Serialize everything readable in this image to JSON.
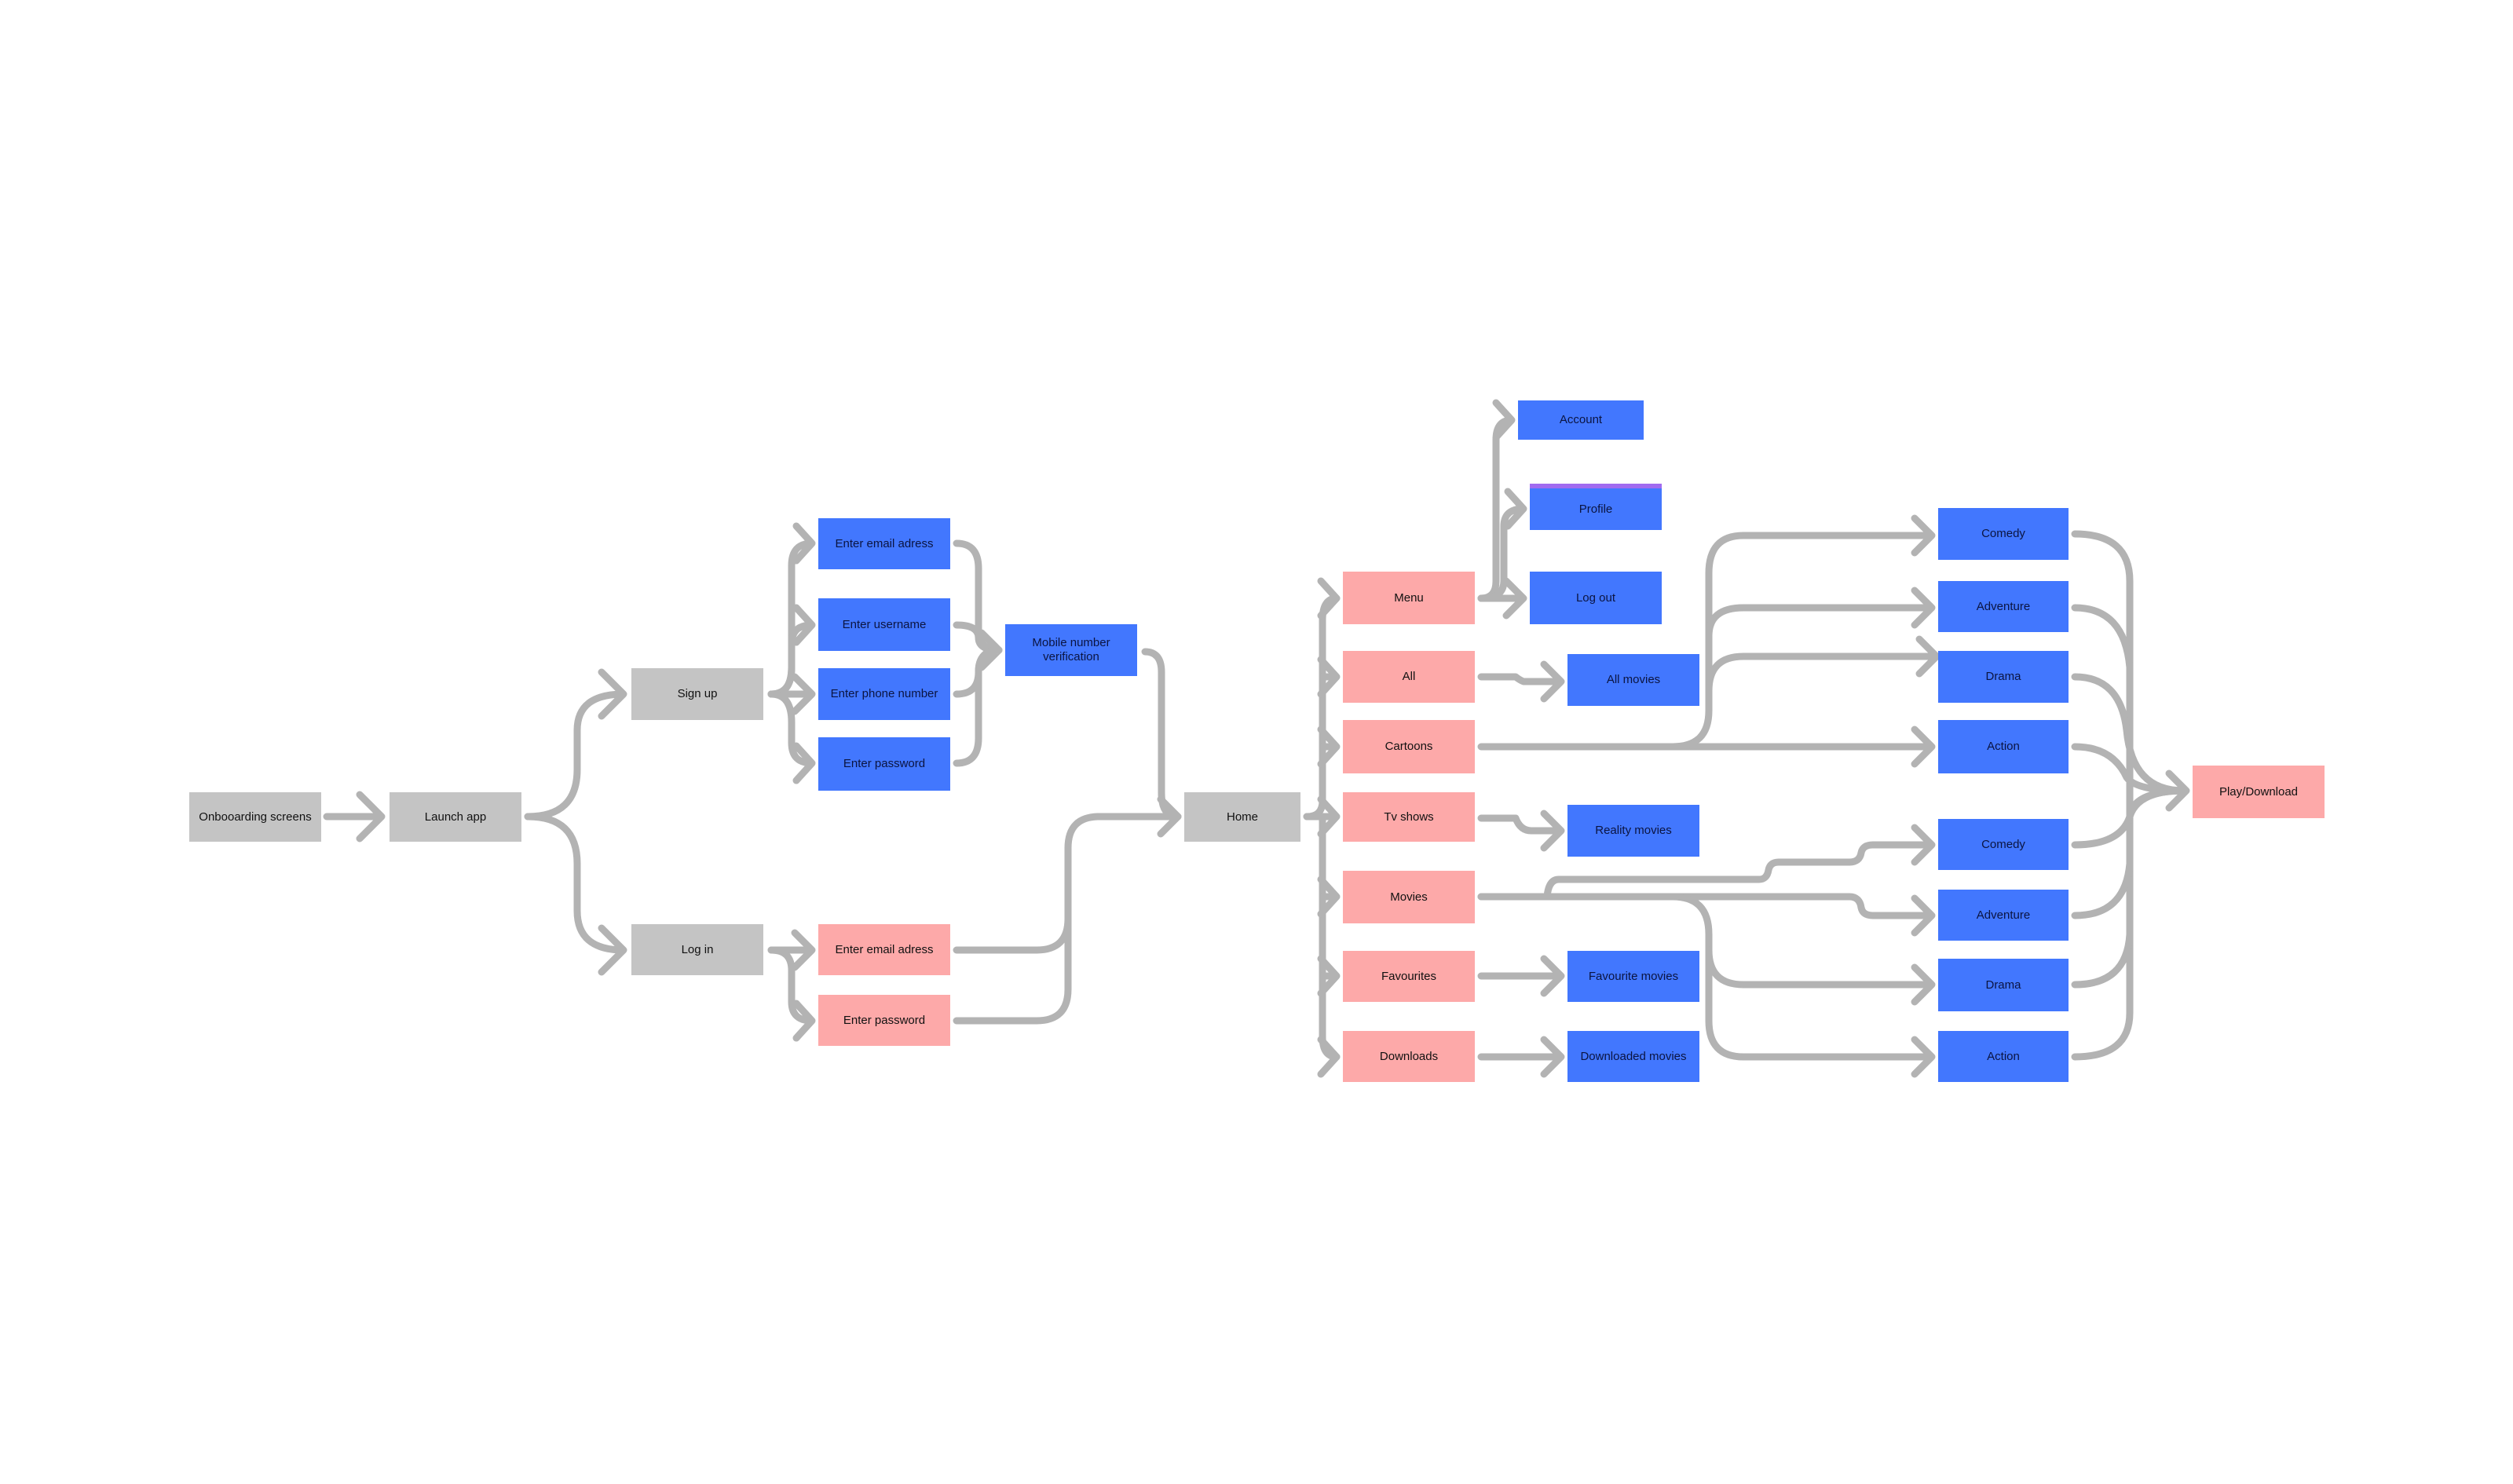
{
  "diagram": {
    "type": "user-flow",
    "colors": {
      "screen": "#c4c4c4",
      "input_step": "#4277fe",
      "action": "#fda9a9",
      "connector": "#b3b3b3",
      "selection_accent": "#a16bf0"
    },
    "nodes": {
      "onboarding": "Onbooarding screens",
      "launch_app": "Launch app",
      "sign_up": "Sign up",
      "log_in": "Log in",
      "signup_email": "Enter email adress",
      "signup_username": "Enter username",
      "signup_phone": "Enter phone number",
      "signup_password": "Enter password",
      "mobile_verification": "Mobile number verification",
      "login_email": "Enter email adress",
      "login_password": "Enter password",
      "home": "Home",
      "menu": "Menu",
      "all": "All",
      "cartoons": "Cartoons",
      "tv_shows": "Tv shows",
      "movies": "Movies",
      "favourites": "Favourites",
      "downloads": "Downloads",
      "account": "Account",
      "profile": "Profile",
      "log_out": "Log out",
      "all_movies": "All movies",
      "reality_movies": "Reality movies",
      "favourite_movies": "Favourite movies",
      "downloaded_movies": "Downloaded movies",
      "cartoon_comedy": "Comedy",
      "cartoon_adventure": "Adventure",
      "cartoon_drama": "Drama",
      "cartoon_action": "Action",
      "movie_comedy": "Comedy",
      "movie_adventure": "Adventure",
      "movie_drama": "Drama",
      "movie_action": "Action",
      "play_download": "Play/Download"
    },
    "edges": [
      [
        "onboarding",
        "launch_app"
      ],
      [
        "launch_app",
        "sign_up"
      ],
      [
        "launch_app",
        "log_in"
      ],
      [
        "sign_up",
        "signup_email"
      ],
      [
        "sign_up",
        "signup_username"
      ],
      [
        "sign_up",
        "signup_phone"
      ],
      [
        "sign_up",
        "signup_password"
      ],
      [
        "signup_email",
        "mobile_verification"
      ],
      [
        "signup_username",
        "mobile_verification"
      ],
      [
        "signup_phone",
        "mobile_verification"
      ],
      [
        "signup_password",
        "mobile_verification"
      ],
      [
        "mobile_verification",
        "home"
      ],
      [
        "log_in",
        "login_email"
      ],
      [
        "log_in",
        "login_password"
      ],
      [
        "login_email",
        "home"
      ],
      [
        "login_password",
        "home"
      ],
      [
        "home",
        "menu"
      ],
      [
        "home",
        "all"
      ],
      [
        "home",
        "cartoons"
      ],
      [
        "home",
        "tv_shows"
      ],
      [
        "home",
        "movies"
      ],
      [
        "home",
        "favourites"
      ],
      [
        "home",
        "downloads"
      ],
      [
        "menu",
        "account"
      ],
      [
        "menu",
        "profile"
      ],
      [
        "menu",
        "log_out"
      ],
      [
        "all",
        "all_movies"
      ],
      [
        "tv_shows",
        "reality_movies"
      ],
      [
        "favourites",
        "favourite_movies"
      ],
      [
        "downloads",
        "downloaded_movies"
      ],
      [
        "cartoons",
        "cartoon_comedy"
      ],
      [
        "cartoons",
        "cartoon_adventure"
      ],
      [
        "cartoons",
        "cartoon_drama"
      ],
      [
        "cartoons",
        "cartoon_action"
      ],
      [
        "movies",
        "movie_comedy"
      ],
      [
        "movies",
        "movie_adventure"
      ],
      [
        "movies",
        "movie_drama"
      ],
      [
        "movies",
        "movie_action"
      ],
      [
        "cartoon_comedy",
        "play_download"
      ],
      [
        "cartoon_adventure",
        "play_download"
      ],
      [
        "cartoon_drama",
        "play_download"
      ],
      [
        "cartoon_action",
        "play_download"
      ],
      [
        "movie_comedy",
        "play_download"
      ],
      [
        "movie_adventure",
        "play_download"
      ],
      [
        "movie_drama",
        "play_download"
      ],
      [
        "movie_action",
        "play_download"
      ]
    ]
  }
}
